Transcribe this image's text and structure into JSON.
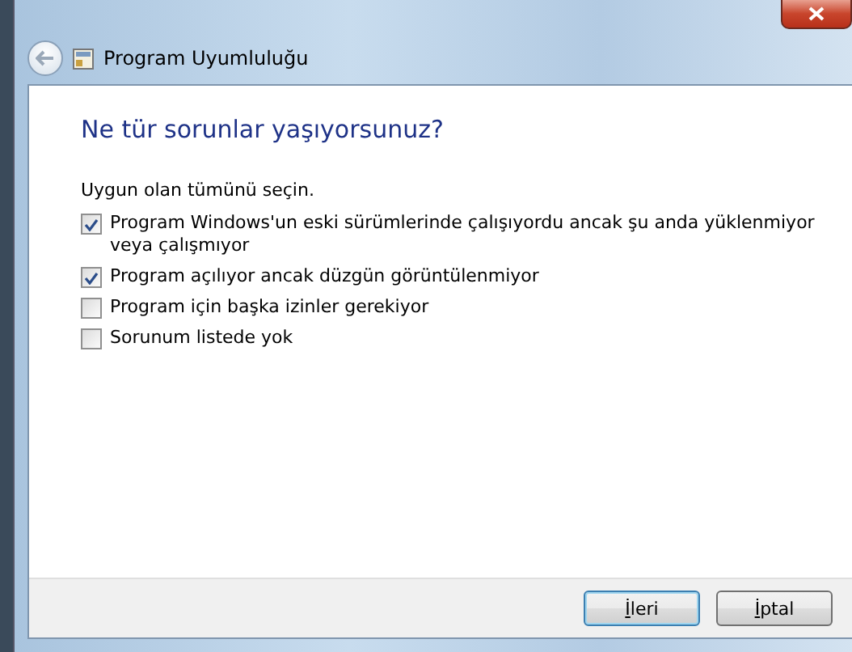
{
  "window": {
    "title": "Program Uyumluluğu"
  },
  "heading": "Ne tür sorunlar yaşıyorsunuz?",
  "instruction": "Uygun olan tümünü seçin.",
  "options": [
    {
      "label": "Program Windows'un eski sürümlerinde çalışıyordu ancak şu anda yüklenmiyor veya çalışmıyor",
      "checked": true
    },
    {
      "label": "Program açılıyor ancak düzgün görüntülenmiyor",
      "checked": true
    },
    {
      "label": "Program için başka izinler gerekiyor",
      "checked": false
    },
    {
      "label": "Sorunum listede yok",
      "checked": false
    }
  ],
  "buttons": [
    {
      "label": "İleri",
      "selected": true
    },
    {
      "label": "İptal",
      "selected": false
    }
  ]
}
